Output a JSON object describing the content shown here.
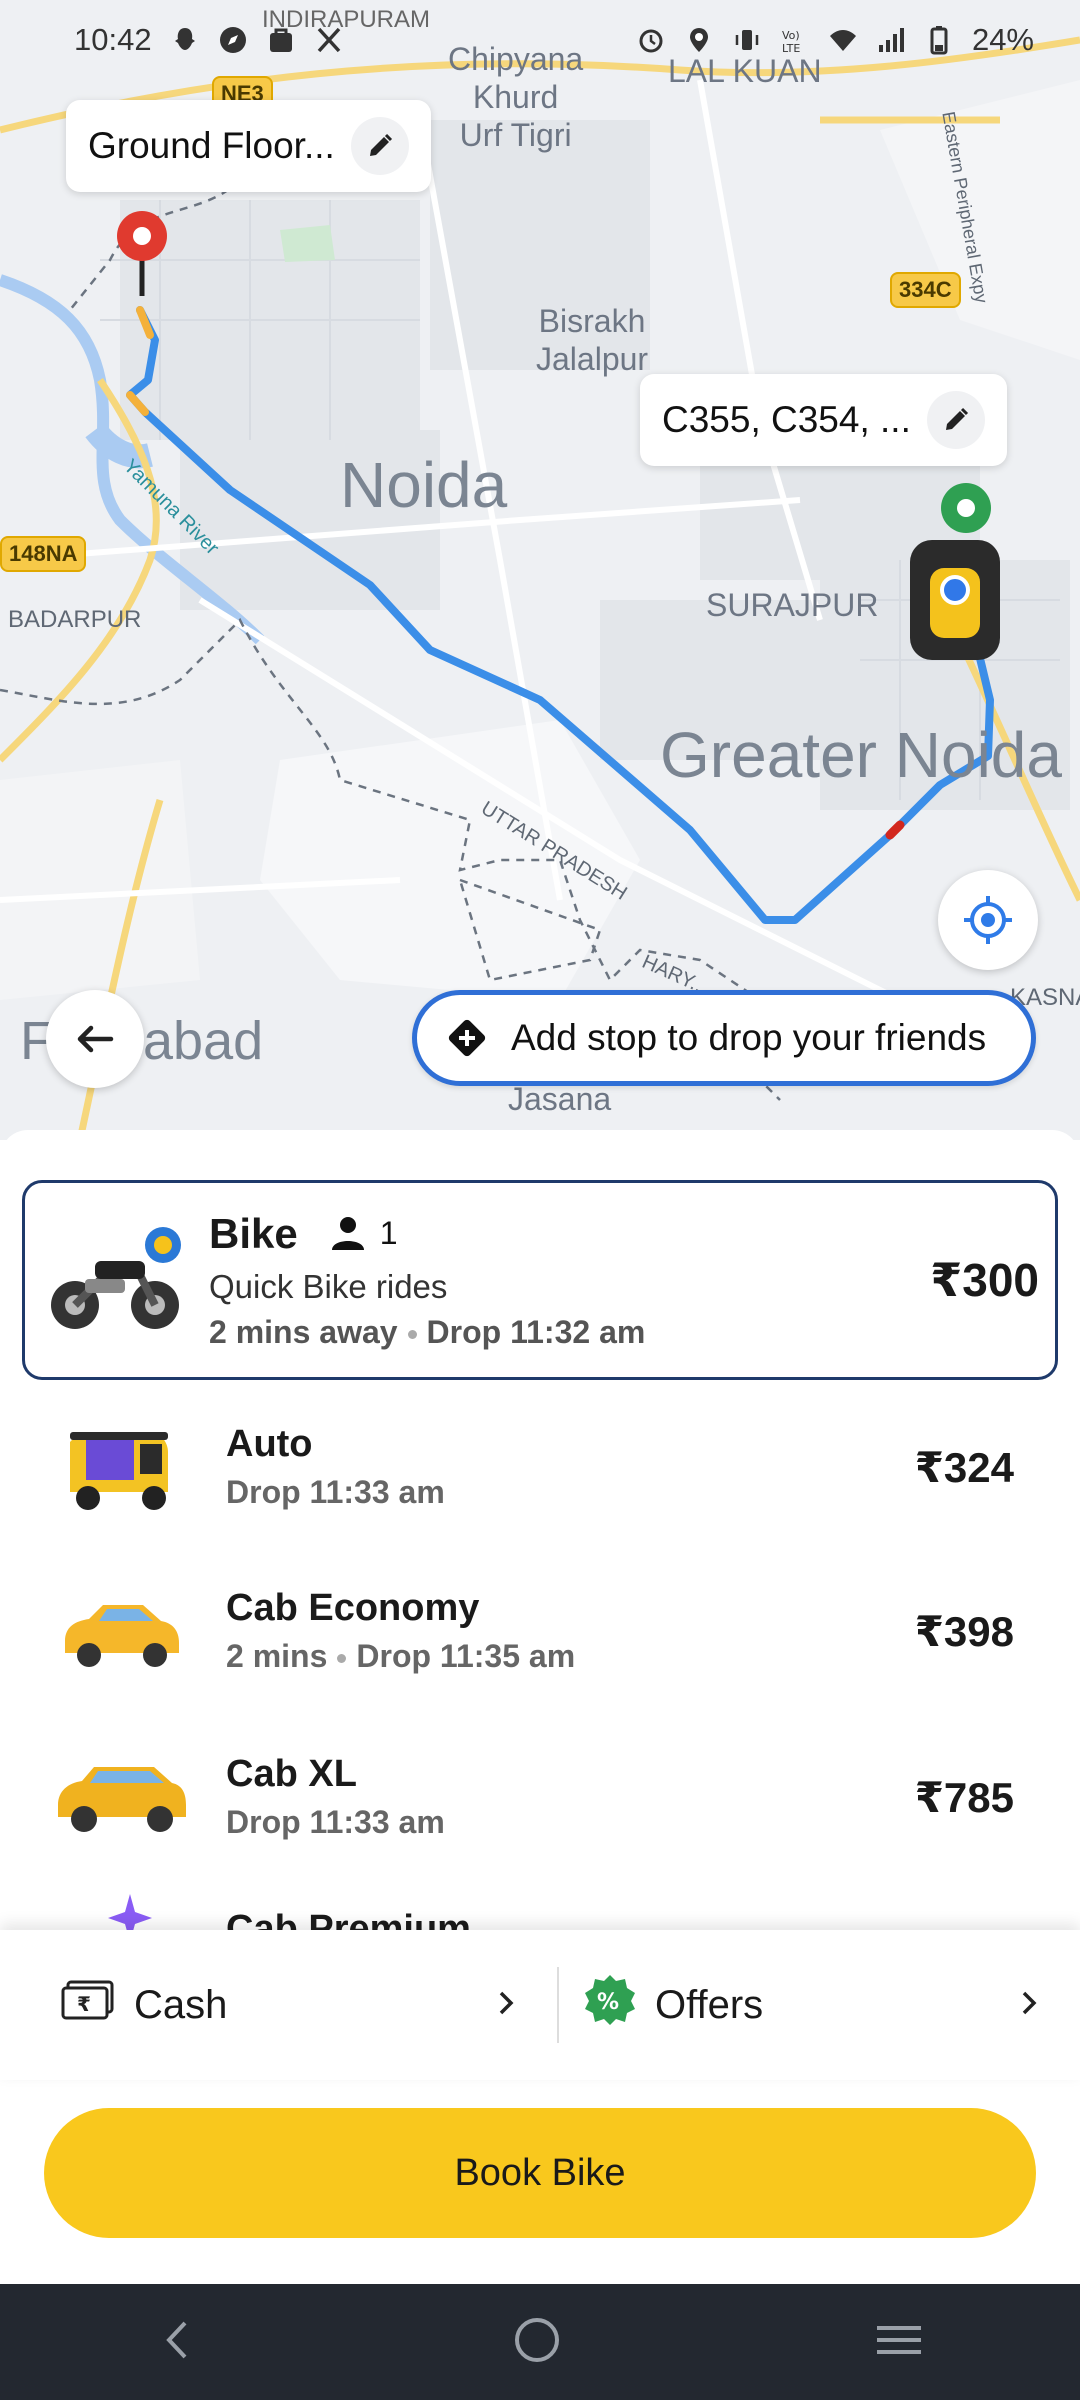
{
  "status_bar": {
    "time": "10:42",
    "battery": "24%"
  },
  "map": {
    "places": {
      "indirapuram": "INDIRAPURAM",
      "chipyana": "Chipyana\nKhurd\nUrf Tigri",
      "lal_kuan": "LAL KUAN",
      "bisrakh": "Bisrakh\nJalalpur",
      "noida": "Noida",
      "surajpur": "SURAJPUR",
      "greater_noida": "Greater Noida",
      "badarpur": "BADARPUR",
      "uttar_pradesh": "UTTAR PRADESH",
      "yamuna_river": "Yamuna River",
      "faridabad": "Faridabad",
      "jasana": "Jasana",
      "kasna": "KASNA",
      "harya": "HARY...",
      "eastern_peripheral": "Eastern Peripheral Expy"
    },
    "shields": {
      "nh3": "NE3",
      "r334c": "334C",
      "r148na": "148NA"
    },
    "pickup_chip": "Ground Floor...",
    "drop_chip": "C355, C354, ...",
    "add_stop": "Add stop to drop your friends"
  },
  "rides": [
    {
      "name": "Bike",
      "capacity": "1",
      "subtitle": "Quick Bike rides",
      "eta": "2 mins away",
      "drop": "Drop 11:32 am",
      "price": "₹300",
      "selected": true
    },
    {
      "name": "Auto",
      "eta": "",
      "drop": "Drop 11:33 am",
      "price": "₹324"
    },
    {
      "name": "Cab Economy",
      "eta": "2 mins",
      "drop": "Drop 11:35 am",
      "price": "₹398"
    },
    {
      "name": "Cab XL",
      "eta": "",
      "drop": "Drop 11:33 am",
      "price": "₹785"
    },
    {
      "name": "Cab Premium"
    }
  ],
  "payment": {
    "method": "Cash",
    "offers": "Offers"
  },
  "book_button": "Book Bike",
  "colors": {
    "accent_yellow": "#f9c81d",
    "route_blue": "#3b8ee8",
    "selected_border": "#1f3a6b"
  }
}
